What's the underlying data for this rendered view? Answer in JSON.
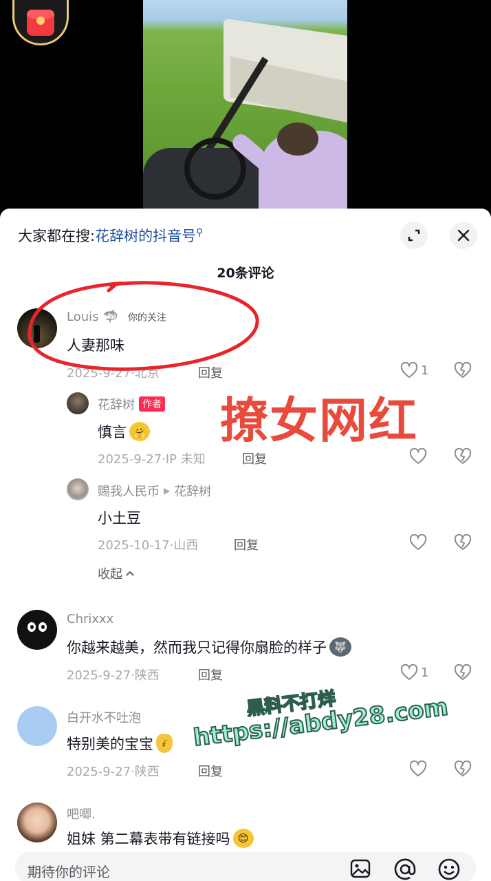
{
  "search": {
    "prefix": "大家都在搜:",
    "keyword": "花辞树的抖音号"
  },
  "comment_count": "20条评论",
  "comments": [
    {
      "user": "Louis",
      "follow_tag": "你的关注",
      "text": "人妻那味",
      "date": "2025-9-27·北京",
      "reply": "回复",
      "likes": "1"
    },
    {
      "user": "花辞树",
      "badge": "作者",
      "text": "慎言",
      "date": "2025-9-27·IP 未知",
      "reply": "回复",
      "likes": ""
    },
    {
      "user": "赐我人民币",
      "reply_to": "花辞树",
      "text": "小土豆",
      "date": "2025-10-17·山西",
      "reply": "回复",
      "likes": ""
    },
    {
      "user": "Chrixxx",
      "text": "你越来越美，然而我只记得你扇脸的样子",
      "date": "2025-9-27·陕西",
      "reply": "回复",
      "likes": "1"
    },
    {
      "user": "白开水不吐泡",
      "text": "特别美的宝宝",
      "date": "2025-9-27·陕西",
      "reply": "回复",
      "likes": ""
    },
    {
      "user": "吧唧.",
      "text": "姐妹 第二幕表带有链接吗"
    }
  ],
  "collapse_label": "收起",
  "overlay": {
    "headline": "撩女网红",
    "watermark_line1": "黑料不打烊",
    "watermark_line2": "https://abdy28.com"
  },
  "input": {
    "placeholder": "期待你的评论"
  },
  "icons": [
    "red-packet-icon",
    "expand-icon",
    "close-icon",
    "heart-icon",
    "broken-heart-icon",
    "chevron-up-icon",
    "image-icon",
    "at-icon",
    "emoji-icon"
  ],
  "colors": {
    "author_badge": "#fe2c55",
    "search_keyword": "#1d4e9f",
    "annotation_red": "#e84a3c"
  }
}
